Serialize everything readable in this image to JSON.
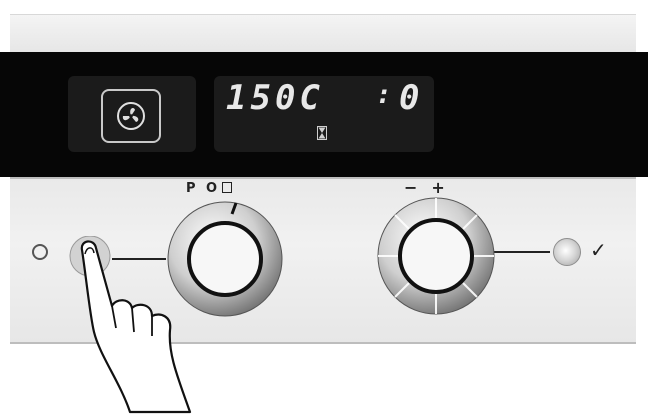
{
  "display": {
    "mode_icon": "fan-icon",
    "temperature": "150C",
    "colon": ":",
    "time": "0",
    "timer_icon": "hourglass-icon"
  },
  "controls": {
    "left_knob_label": "P O",
    "left_knob_box_icon": "square-outline-icon",
    "right_knob_minus": "−",
    "right_knob_plus": "+",
    "power_icon": "circle-outline-icon",
    "confirm_icon": "check-icon",
    "confirm_glyph": "✓"
  }
}
